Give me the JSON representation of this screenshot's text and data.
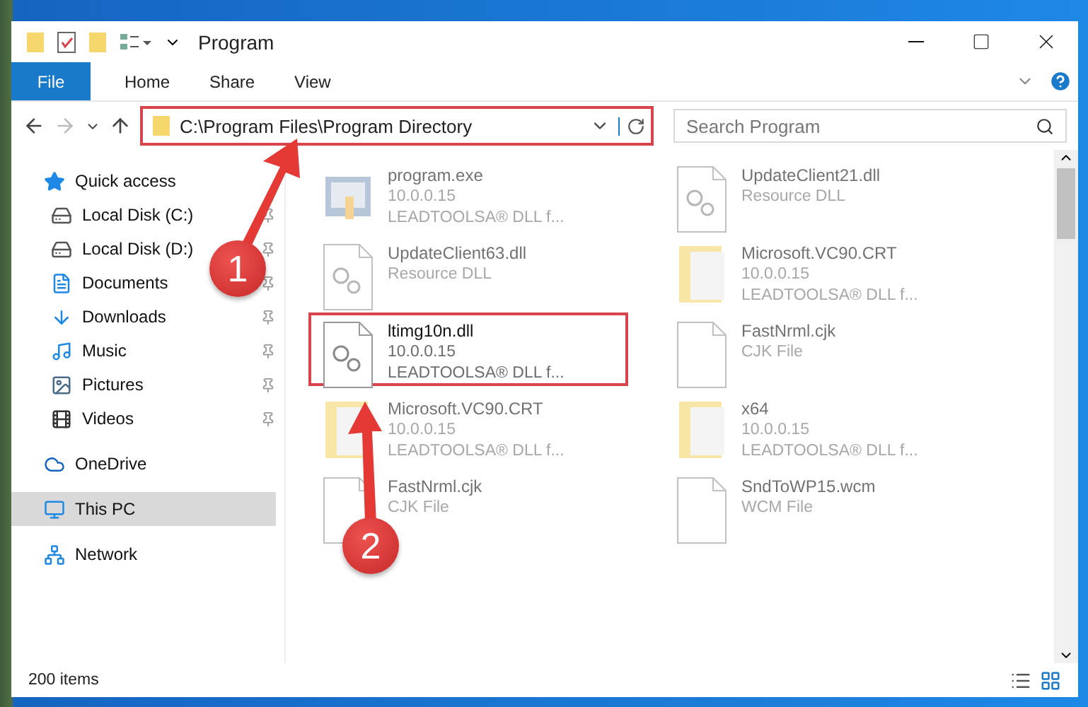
{
  "window": {
    "title": "Program"
  },
  "ribbon_tabs": [
    {
      "label": "File",
      "selected": true
    },
    {
      "label": "Home",
      "selected": false
    },
    {
      "label": "Share",
      "selected": false
    },
    {
      "label": "View",
      "selected": false
    }
  ],
  "address": {
    "path": "C:\\Program Files\\Program Directory",
    "highlighted": true
  },
  "search": {
    "placeholder": "Search Program"
  },
  "sidebar": {
    "items": [
      {
        "label": "Quick access",
        "kind": "star",
        "pinned": false,
        "selected": false,
        "children": [
          {
            "label": "Local Disk (C:)",
            "kind": "drive",
            "pinned": true,
            "selected": false
          },
          {
            "label": "Local Disk (D:)",
            "kind": "drive",
            "pinned": true,
            "selected": false
          },
          {
            "label": "Documents",
            "kind": "documents",
            "pinned": true,
            "selected": false
          },
          {
            "label": "Downloads",
            "kind": "downloads",
            "pinned": true,
            "selected": false
          },
          {
            "label": "Music",
            "kind": "music",
            "pinned": true,
            "selected": false
          },
          {
            "label": "Pictures",
            "kind": "pictures",
            "pinned": true,
            "selected": false
          },
          {
            "label": "Videos",
            "kind": "videos",
            "pinned": true,
            "selected": false
          }
        ]
      },
      {
        "label": "OneDrive",
        "kind": "cloud",
        "pinned": false,
        "selected": false
      },
      {
        "label": "This PC",
        "kind": "pc",
        "pinned": false,
        "selected": true
      },
      {
        "label": "Network",
        "kind": "network",
        "pinned": false,
        "selected": false
      }
    ]
  },
  "files": [
    {
      "name": "program.exe",
      "lines": [
        "10.0.0.15",
        "LEADTOOLSA® DLL f..."
      ],
      "kind": "exe",
      "highlighted": false
    },
    {
      "name": "UpdateClient21.dll",
      "lines": [
        "Resource DLL"
      ],
      "kind": "dll",
      "highlighted": false
    },
    {
      "name": "UpdateClient63.dll",
      "lines": [
        "Resource DLL"
      ],
      "kind": "dll",
      "highlighted": false
    },
    {
      "name": "Microsoft.VC90.CRT",
      "lines": [
        "10.0.0.15",
        "LEADTOOLSA® DLL f..."
      ],
      "kind": "folder",
      "highlighted": false
    },
    {
      "name": "ltimg10n.dll",
      "lines": [
        "10.0.0.15",
        "LEADTOOLSA® DLL f..."
      ],
      "kind": "dll",
      "highlighted": true
    },
    {
      "name": "FastNrml.cjk",
      "lines": [
        "CJK File"
      ],
      "kind": "file",
      "highlighted": false
    },
    {
      "name": "Microsoft.VC90.CRT",
      "lines": [
        "10.0.0.15",
        "LEADTOOLSA® DLL f..."
      ],
      "kind": "folder",
      "highlighted": false
    },
    {
      "name": "x64",
      "lines": [
        "10.0.0.15",
        "LEADTOOLSA® DLL f..."
      ],
      "kind": "folder",
      "highlighted": false
    },
    {
      "name": "FastNrml.cjk",
      "lines": [
        "CJK File"
      ],
      "kind": "file",
      "highlighted": false
    },
    {
      "name": "SndToWP15.wcm",
      "lines": [
        "WCM File"
      ],
      "kind": "file",
      "highlighted": false
    }
  ],
  "status_bar": {
    "count": "200 items"
  },
  "annotations": [
    {
      "label": "1"
    },
    {
      "label": "2"
    }
  ]
}
